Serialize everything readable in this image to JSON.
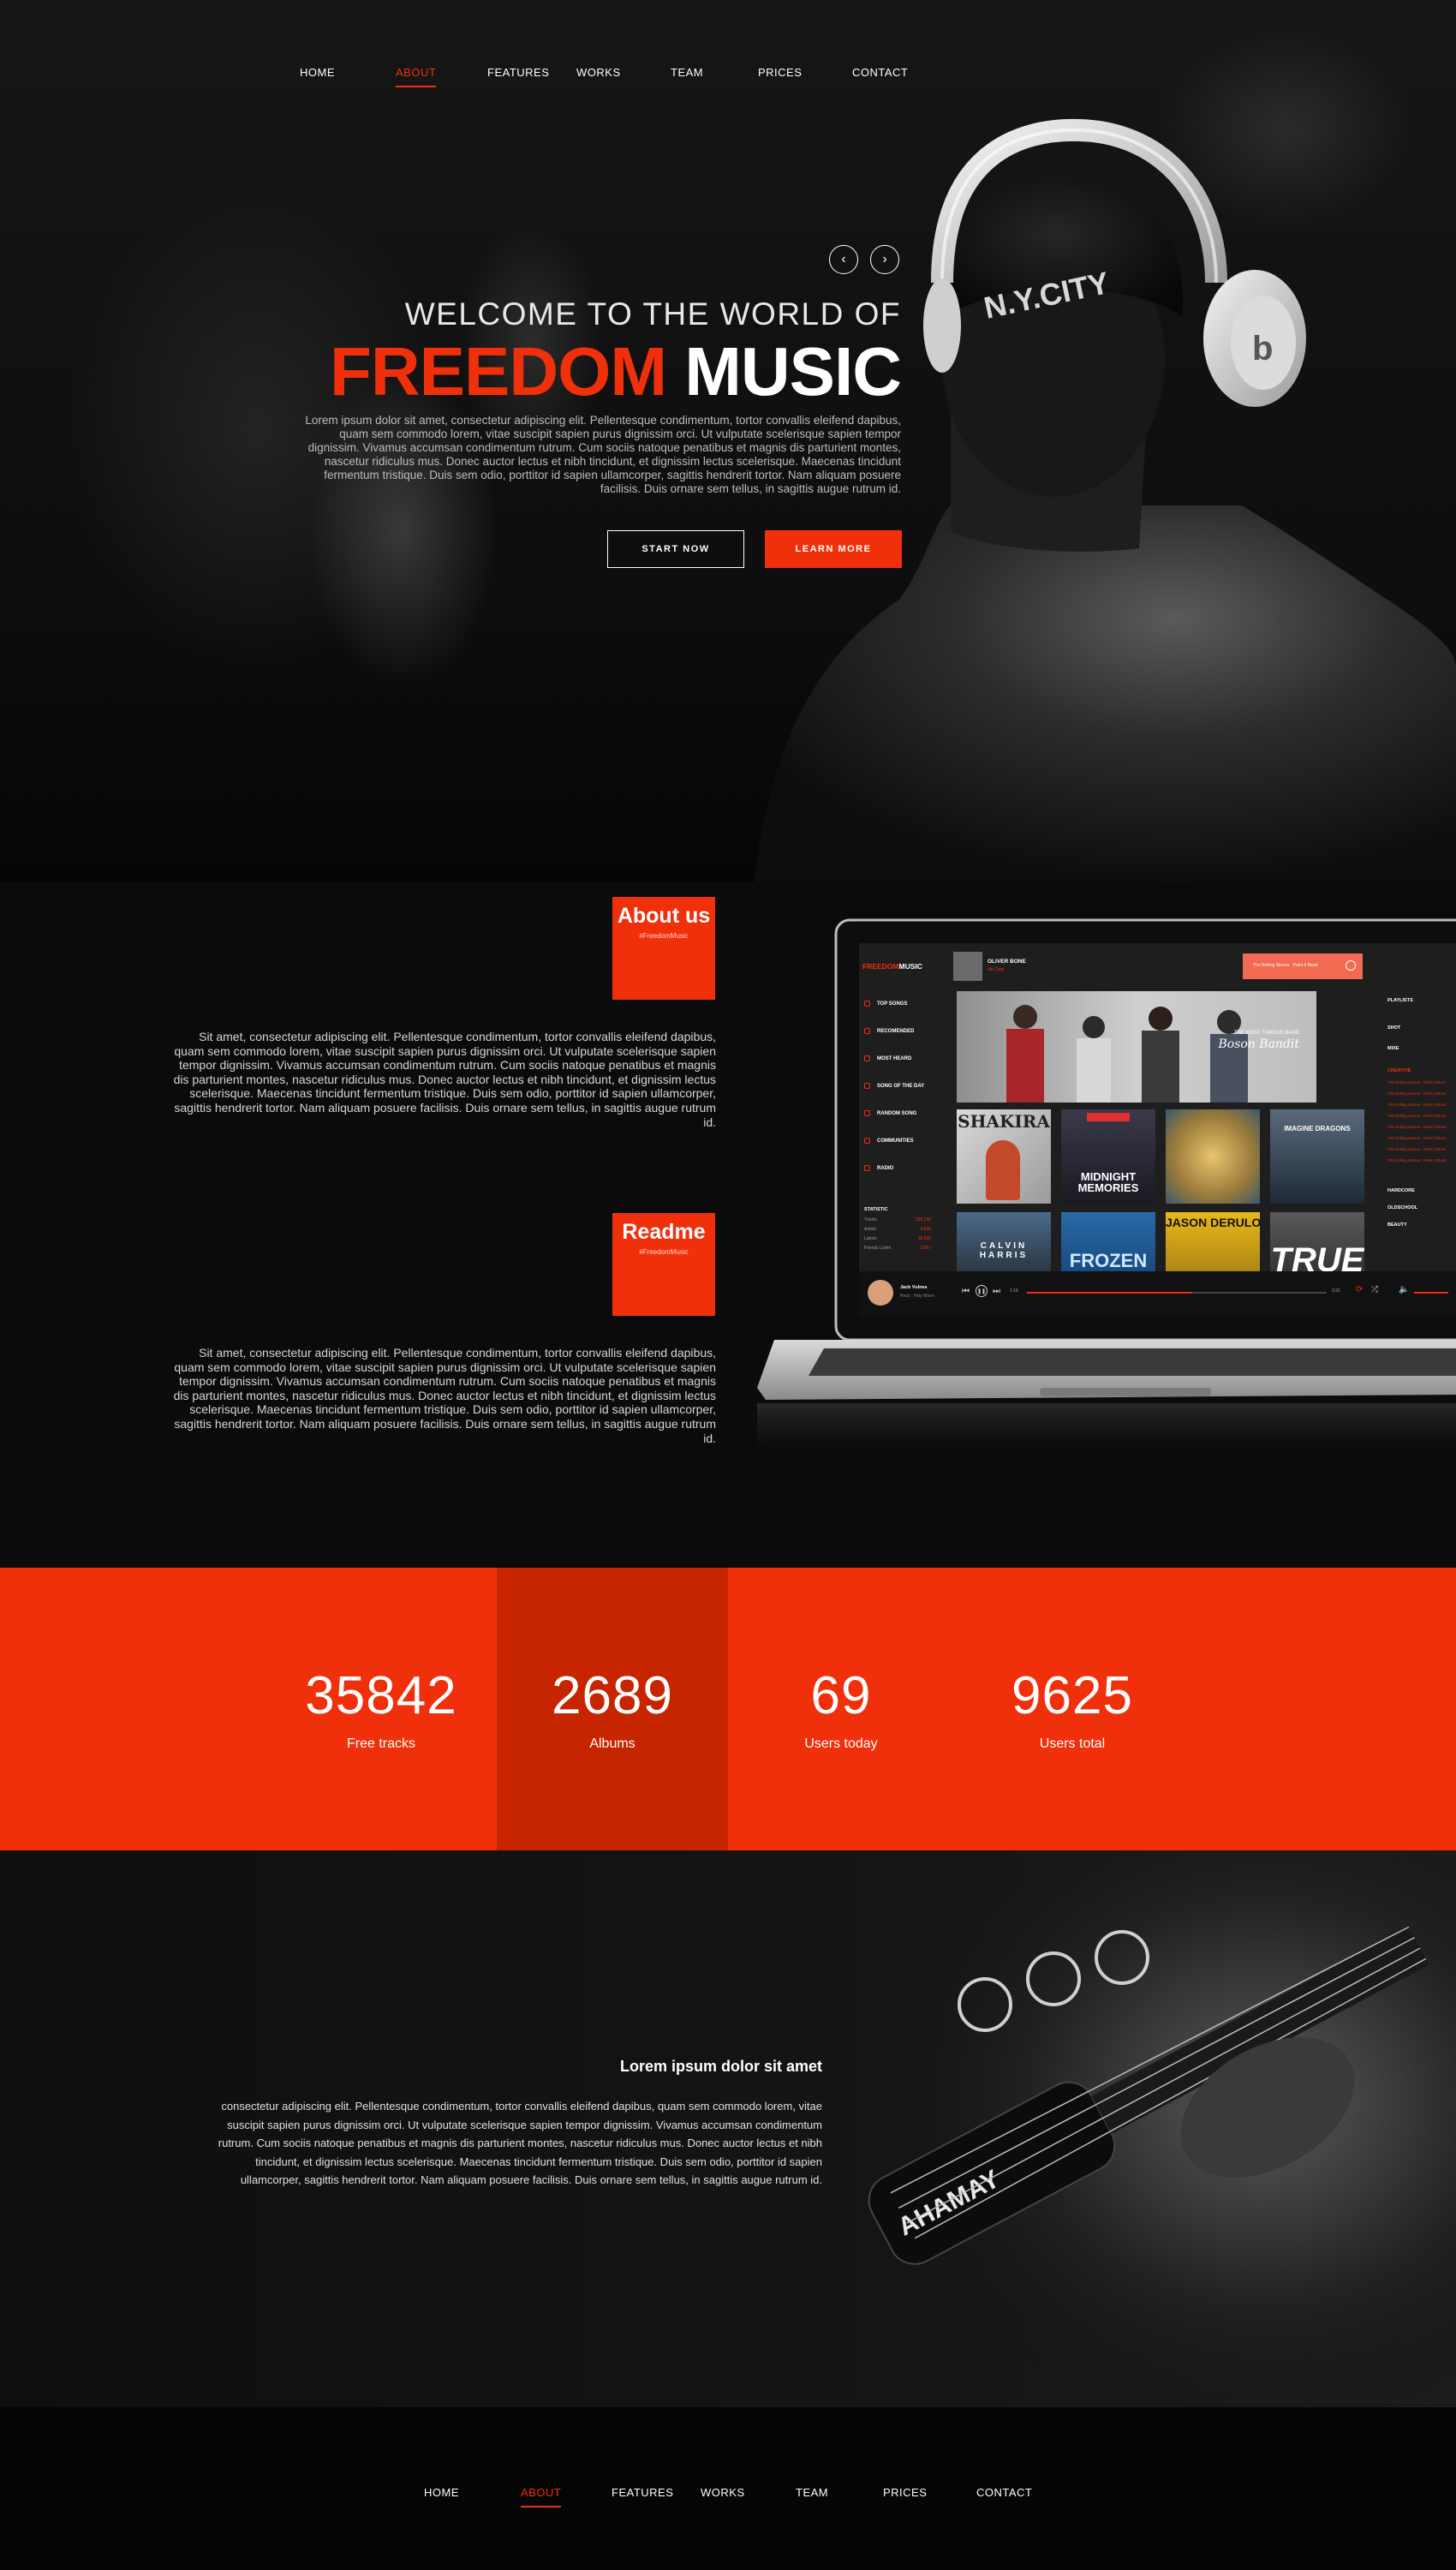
{
  "nav": {
    "items": [
      "HOME",
      "ABOUT",
      "FEATURES",
      "WORKS",
      "TEAM",
      "PRICES",
      "CONTACT"
    ],
    "active": "ABOUT"
  },
  "hero": {
    "prev_icon": "chevron-left-icon",
    "next_icon": "chevron-right-icon",
    "welcome": "WELCOME TO THE WORLD OF",
    "headline_red": "FREEDOM",
    "headline_white": "MUSIC",
    "text": "Lorem ipsum dolor sit amet, consectetur adipiscing elit. Pellentesque condimentum, tortor convallis eleifend dapibus, quam sem commodo lorem, vitae suscipit sapien purus dignissim orci. Ut vulputate scelerisque sapien tempor dignissim. Vivamus accumsan condimentum rutrum. Cum sociis natoque penatibus et magnis dis parturient montes, nascetur ridiculus mus. Donec auctor lectus et nibh tincidunt, et dignissim lectus scelerisque. Maecenas tincidunt fermentum tristique. Duis sem odio, porttitor id sapien ullamcorper, sagittis hendrerit tortor. Nam aliquam posuere facilisis. Duis ornare sem tellus, in sagittis augue rutrum id.",
    "btn_start": "START NOW",
    "btn_learn": "LEARN MORE",
    "cap_text": "N.Y.CITY"
  },
  "about": {
    "title": "About us",
    "tag": "#FreedomMusic",
    "text": "Sit amet, consectetur adipiscing elit. Pellentesque condimentum, tortor convallis eleifend dapibus, quam sem commodo lorem, vitae suscipit sapien purus dignissim orci. Ut vulputate scelerisque sapien tempor dignissim. Vivamus accumsan condimentum rutrum. Cum sociis natoque penatibus et magnis dis parturient montes, nascetur ridiculus mus. Donec auctor lectus et nibh tincidunt, et dignissim lectus scelerisque. Maecenas tincidunt fermentum tristique. Duis sem odio, porttitor id sapien ullamcorper, sagittis hendrerit tortor. Nam aliquam posuere facilisis. Duis ornare sem tellus, in sagittis augue rutrum id."
  },
  "readme": {
    "title": "Readme",
    "tag": "#FreedomMusic",
    "text": "Sit amet, consectetur adipiscing elit. Pellentesque condimentum, tortor convallis eleifend dapibus, quam sem commodo lorem, vitae suscipit sapien purus dignissim orci. Ut vulputate scelerisque sapien tempor dignissim. Vivamus accumsan condimentum rutrum. Cum sociis natoque penatibus et magnis dis parturient montes, nascetur ridiculus mus. Donec auctor lectus et nibh tincidunt, et dignissim lectus scelerisque. Maecenas tincidunt fermentum tristique. Duis sem odio, porttitor id sapien ullamcorper, sagittis hendrerit tortor. Nam aliquam posuere facilisis. Duis ornare sem tellus, in sagittis augue rutrum id."
  },
  "app": {
    "logo_red": "FREEDOM",
    "logo_white": "MUSIC",
    "now_title": "OLIVER BONE",
    "now_sub": "Hit Cast",
    "search": "The Rolling Stones - Paint It Black",
    "sidebar": [
      "TOP SONGS",
      "RECOMENDED",
      "MOST HEARD",
      "SONG OF THE DAY",
      "RANDOM SONG",
      "COMMUNITIES",
      "RADIO"
    ],
    "stat_title": "STATISTIC",
    "stats": [
      {
        "label": "Tracks",
        "value": "358,236"
      },
      {
        "label": "Artists",
        "value": "9,836"
      },
      {
        "label": "Labels",
        "value": "38,936"
      },
      {
        "label": "Friends Listen",
        "value": "2,657"
      }
    ],
    "banner_small": "THE MOST FAMOUS BAND",
    "banner_name": "Boson Bandit",
    "albums": [
      "SHAKIRA",
      "MIDNIGHT MEMORIES",
      "",
      "IMAGINE DRAGONS",
      "CALVIN HARRIS",
      "FROZEN",
      "JASON DERULO",
      "TRUE"
    ],
    "right_top": [
      "PLAYLISTS",
      "SHOT",
      "MIXE",
      "CREATIVE"
    ],
    "right_tracks": [
      "The Rolling Stones - Paint It Black",
      "The Rolling Stones - Paint It Black",
      "The Rolling Stones - Paint It Black",
      "The Rolling Stones - Paint It Black",
      "The Rolling Stones - Paint It Black",
      "The Rolling Stones - Paint It Black",
      "The Rolling Stones - Paint It Black",
      "The Rolling Stones - Paint It Black"
    ],
    "right_bottom": [
      "HARDCORE",
      "OLDSCHOOL",
      "BEAUTY"
    ],
    "player_name": "Jack Vulnes",
    "player_sub": "Rock · Holy Moon",
    "time_start": "1:16",
    "time_end": "3:31",
    "progress": 0.55
  },
  "stats": [
    {
      "num": "35842",
      "label": "Free tracks"
    },
    {
      "num": "2689",
      "label": "Albums"
    },
    {
      "num": "69",
      "label": "Users today"
    },
    {
      "num": "9625",
      "label": "Users total"
    }
  ],
  "guitar": {
    "title": "Lorem ipsum dolor sit amet",
    "text": "consectetur adipiscing elit. Pellentesque condimentum, tortor convallis eleifend dapibus, quam sem commodo lorem, vitae suscipit sapien purus dignissim orci. Ut vulputate scelerisque sapien tempor dignissim. Vivamus accumsan condimentum rutrum. Cum sociis natoque penatibus et magnis dis parturient montes, nascetur ridiculus mus. Donec auctor lectus et nibh tincidunt, et dignissim lectus scelerisque. Maecenas tincidunt fermentum tristique. Duis sem odio, porttitor id sapien ullamcorper, sagittis hendrerit tortor. Nam aliquam posuere facilisis. Duis ornare sem tellus, in sagittis augue rutrum id.",
    "brand": "AHAMAY"
  },
  "colors": {
    "accent": "#f0300b",
    "accent_dark": "#c62500",
    "background": "#0b0b0b"
  }
}
